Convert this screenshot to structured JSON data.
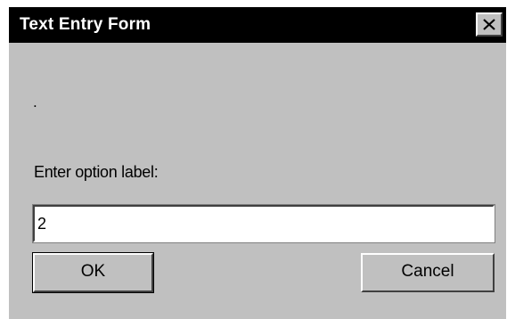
{
  "window": {
    "title": "Text Entry Form",
    "close_icon": "close-icon"
  },
  "body": {
    "dot_text": ".",
    "prompt_label": "Enter option label:",
    "input_value": "2"
  },
  "buttons": {
    "ok_label": "OK",
    "cancel_label": "Cancel"
  },
  "colors": {
    "titlebar_bg": "#000000",
    "titlebar_text": "#ffffff",
    "dialog_bg": "#c0c0c0",
    "input_bg": "#ffffff"
  }
}
